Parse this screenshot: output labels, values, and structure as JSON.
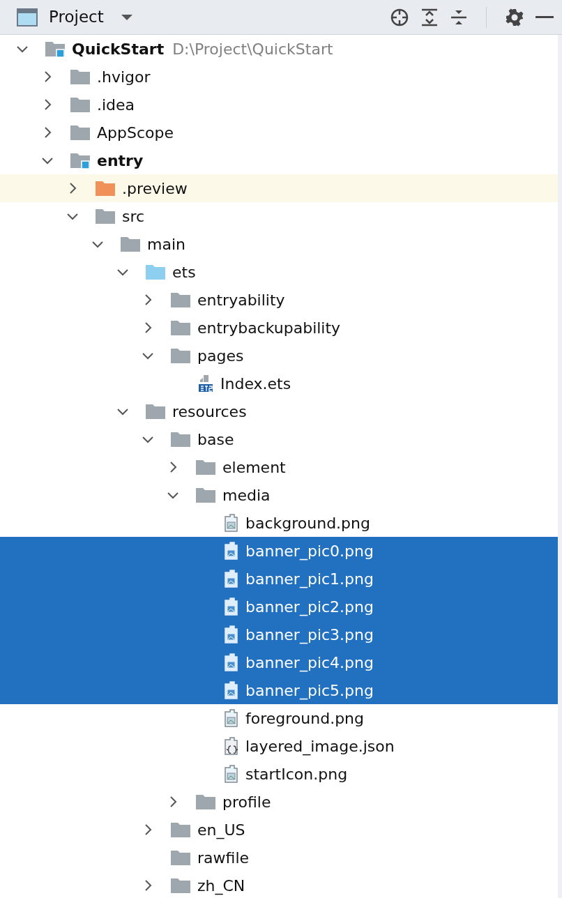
{
  "header": {
    "title": "Project"
  },
  "tree": [
    {
      "label": "QuickStart",
      "hint": "D:\\Project\\QuickStart",
      "kind": "project",
      "expanded": true,
      "selected": false,
      "children": [
        {
          "label": ".hvigor",
          "kind": "folder",
          "expanded": false,
          "selected": false
        },
        {
          "label": ".idea",
          "kind": "folder",
          "expanded": false,
          "selected": false
        },
        {
          "label": "AppScope",
          "kind": "folder",
          "expanded": false,
          "selected": false
        },
        {
          "label": "entry",
          "kind": "module",
          "expanded": true,
          "selected": false,
          "children": [
            {
              "label": ".preview",
              "kind": "folder-excluded",
              "expanded": false,
              "selected": false,
              "highlighted": true
            },
            {
              "label": "src",
              "kind": "folder",
              "expanded": true,
              "selected": false,
              "children": [
                {
                  "label": "main",
                  "kind": "folder",
                  "expanded": true,
                  "selected": false,
                  "children": [
                    {
                      "label": "ets",
                      "kind": "folder-source",
                      "expanded": true,
                      "selected": false,
                      "children": [
                        {
                          "label": "entryability",
                          "kind": "folder",
                          "expanded": false,
                          "selected": false
                        },
                        {
                          "label": "entrybackupability",
                          "kind": "folder",
                          "expanded": false,
                          "selected": false
                        },
                        {
                          "label": "pages",
                          "kind": "folder",
                          "expanded": true,
                          "selected": false,
                          "children": [
                            {
                              "label": "Index.ets",
                              "kind": "file-ets",
                              "selected": false
                            }
                          ]
                        }
                      ]
                    },
                    {
                      "label": "resources",
                      "kind": "folder",
                      "expanded": true,
                      "selected": false,
                      "children": [
                        {
                          "label": "base",
                          "kind": "folder",
                          "expanded": true,
                          "selected": false,
                          "children": [
                            {
                              "label": "element",
                              "kind": "folder",
                              "expanded": false,
                              "selected": false
                            },
                            {
                              "label": "media",
                              "kind": "folder",
                              "expanded": true,
                              "selected": false,
                              "children": [
                                {
                                  "label": "background.png",
                                  "kind": "file-image",
                                  "selected": false
                                },
                                {
                                  "label": "banner_pic0.png",
                                  "kind": "file-image",
                                  "selected": true
                                },
                                {
                                  "label": "banner_pic1.png",
                                  "kind": "file-image",
                                  "selected": true
                                },
                                {
                                  "label": "banner_pic2.png",
                                  "kind": "file-image",
                                  "selected": true
                                },
                                {
                                  "label": "banner_pic3.png",
                                  "kind": "file-image",
                                  "selected": true
                                },
                                {
                                  "label": "banner_pic4.png",
                                  "kind": "file-image",
                                  "selected": true
                                },
                                {
                                  "label": "banner_pic5.png",
                                  "kind": "file-image",
                                  "selected": true
                                },
                                {
                                  "label": "foreground.png",
                                  "kind": "file-image",
                                  "selected": false
                                },
                                {
                                  "label": "layered_image.json",
                                  "kind": "file-json",
                                  "selected": false
                                },
                                {
                                  "label": "startIcon.png",
                                  "kind": "file-image",
                                  "selected": false
                                }
                              ]
                            },
                            {
                              "label": "profile",
                              "kind": "folder",
                              "expanded": false,
                              "selected": false
                            }
                          ]
                        },
                        {
                          "label": "en_US",
                          "kind": "folder",
                          "expanded": false,
                          "selected": false
                        },
                        {
                          "label": "rawfile",
                          "kind": "folder",
                          "selected": false
                        },
                        {
                          "label": "zh_CN",
                          "kind": "folder",
                          "expanded": false,
                          "selected": false
                        }
                      ]
                    }
                  ]
                }
              ]
            }
          ]
        }
      ]
    }
  ]
}
